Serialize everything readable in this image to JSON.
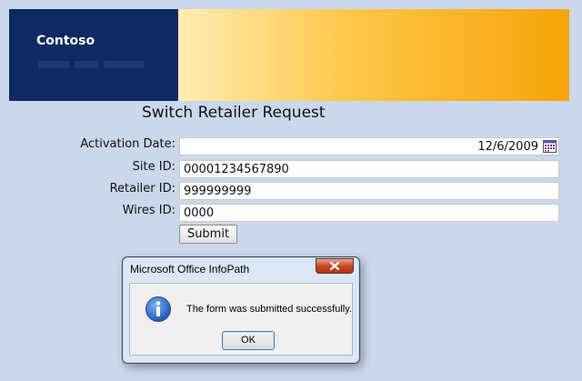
{
  "banner": {
    "company": "Contoso"
  },
  "form": {
    "title": "Switch Retailer Request",
    "fields": [
      {
        "label": "Activation Date:",
        "value": "12/6/2009"
      },
      {
        "label": "Site ID:",
        "value": "00001234567890"
      },
      {
        "label": "Retailer ID:",
        "value": "999999999"
      },
      {
        "label": "Wires ID:",
        "value": "0000"
      }
    ],
    "submit_label": "Submit"
  },
  "dialog": {
    "title": "Microsoft Office InfoPath",
    "message": "The form was submitted successfully.",
    "ok_label": "OK"
  },
  "colors": {
    "page_bg": "#cbd8eb",
    "brand_navy": "#0d2a63",
    "banner_orange": "#f7a308",
    "close_red": "#c4421e"
  }
}
